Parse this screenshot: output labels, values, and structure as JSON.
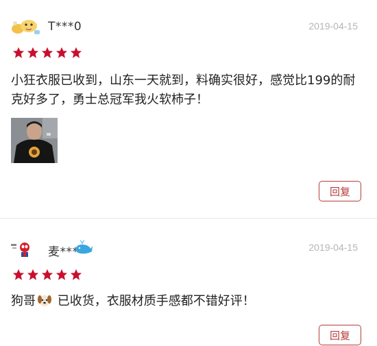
{
  "colors": {
    "accent": "#b73b3b",
    "star": "#c8102e",
    "date": "#b5b5b5",
    "divider": "#e6e6e6"
  },
  "reviews": [
    {
      "username": "T***0",
      "date": "2019-04-15",
      "rating": 5,
      "avatar_icon": "cartoon-character-icon",
      "text": "小狂衣服已收到，山东一天就到，料确实很好，感觉比199的耐克好多了，勇士总冠军我火软柿子！",
      "has_photo": true,
      "reply_label": "回复"
    },
    {
      "username": "麦***",
      "date": "2019-04-15",
      "rating": 5,
      "avatar_icon": "spiderman-icon",
      "badge_icon": "whale-icon",
      "text_before_icon": "狗哥",
      "inline_icon": "dog-face-icon",
      "text_after_icon": " 已收货，衣服材质手感都不错好评！",
      "reply_label": "回复"
    }
  ]
}
